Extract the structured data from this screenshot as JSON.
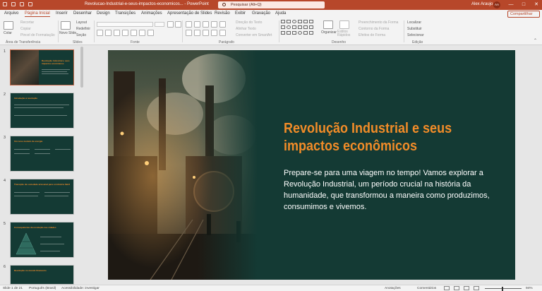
{
  "titlebar": {
    "doc_title": "Revolucao-Industrial-e-seus-impactos-economicos...  -  PowerPoint",
    "search_placeholder": "Pesquisar (Alt+Q)",
    "user_name": "Alex Araujo",
    "user_initials": "AA",
    "minimize": "—",
    "maximize": "□",
    "close": "✕"
  },
  "tabs": {
    "items": [
      "Arquivo",
      "Página Inicial",
      "Inserir",
      "Desenhar",
      "Design",
      "Transições",
      "Animações",
      "Apresentação de Slides",
      "Revisão",
      "Exibir",
      "Gravação",
      "Ajuda"
    ],
    "active": "Página Inicial",
    "share": "Compartilhar"
  },
  "ribbon": {
    "clipboard": {
      "paste": "Colar",
      "cut": "Recortar",
      "copy": "Copiar",
      "format_painter": "Pincel de Formatação",
      "group": "Área de Transferência"
    },
    "slides": {
      "new_slide": "Novo Slide",
      "layout": "Layout",
      "reset": "Redefinir",
      "section": "Seção",
      "group": "Slides"
    },
    "font": {
      "group": "Fonte"
    },
    "paragraph": {
      "text_direction": "Direção do Texto",
      "align_text": "Alinhar Texto",
      "convert_smartart": "Converter em SmartArt",
      "group": "Parágrafo"
    },
    "drawing": {
      "arrange": "Organizar",
      "quick_styles": "Estilos Rápidos",
      "shape_fill": "Preenchimento da Forma",
      "shape_outline": "Contorno da Forma",
      "shape_effects": "Efeitos de Forma",
      "group": "Desenho"
    },
    "editing": {
      "find": "Localizar",
      "replace": "Substituir",
      "select": "Selecionar",
      "group": "Edição"
    }
  },
  "thumbnails": [
    {
      "num": "1",
      "title": "Revolução Industrial e seus impactos econômicos",
      "active": true
    },
    {
      "num": "2",
      "title": "Introdução à revolução",
      "active": false
    },
    {
      "num": "3",
      "title": "Um novo modelo de energia",
      "active": false
    },
    {
      "num": "4",
      "title": "Transição da sociedade artesanal para a indústria fabril",
      "active": false
    },
    {
      "num": "5",
      "title": "Consequências da revolução nas cidades",
      "active": false
    },
    {
      "num": "6",
      "title": "Revolução no mundo financeiro",
      "active": false
    }
  ],
  "slide": {
    "title": "Revolução Industrial e seus impactos econômicos",
    "body": "Prepare-se para uma viagem no tempo! Vamos explorar a Revolução Industrial, um período crucial na história da humanidade, que transformou a maneira como produzimos, consumimos e vivemos."
  },
  "statusbar": {
    "slide_pos": "Slide 1 de 21",
    "language": "Português (Brasil)",
    "accessibility": "Acessibilidade: investigar",
    "notes": "Anotações",
    "comments": "Comentários",
    "zoom": "94%"
  },
  "colors": {
    "accent": "#b7472a",
    "slide_bg": "#143a34",
    "title_orange": "#f28c28"
  }
}
